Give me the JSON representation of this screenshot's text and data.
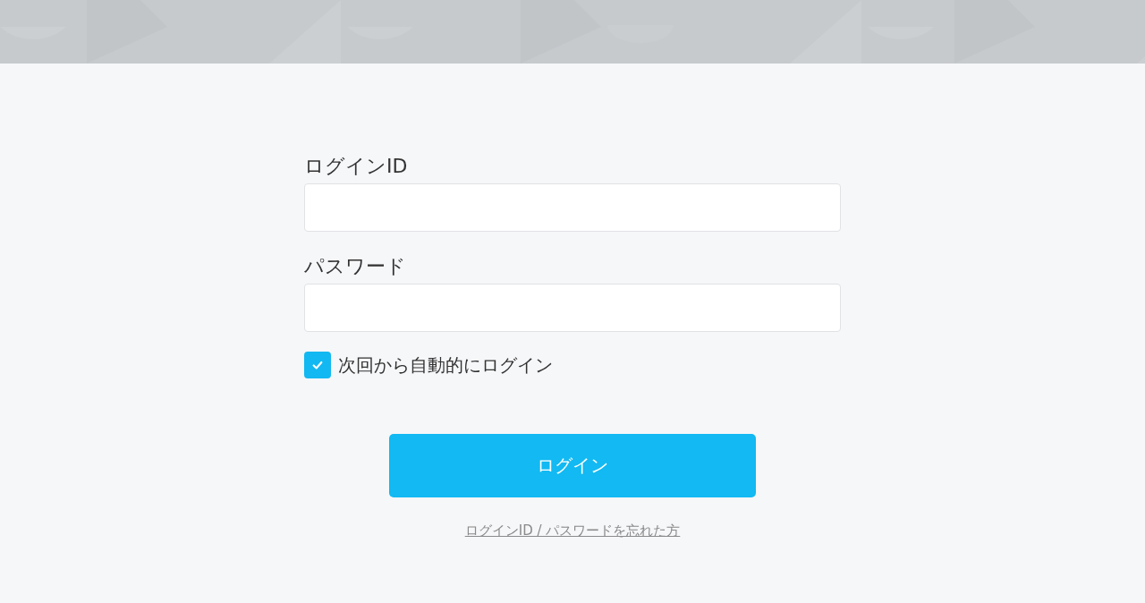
{
  "fields": [
    {
      "label": "ログインID"
    },
    {
      "label": "パスワード"
    }
  ],
  "remember": {
    "label": "次回から自動的にログイン",
    "checked": true
  },
  "login_button": {
    "label": "ログイン"
  },
  "forgot_link": {
    "label": "ログインID / パスワードを忘れた方"
  }
}
